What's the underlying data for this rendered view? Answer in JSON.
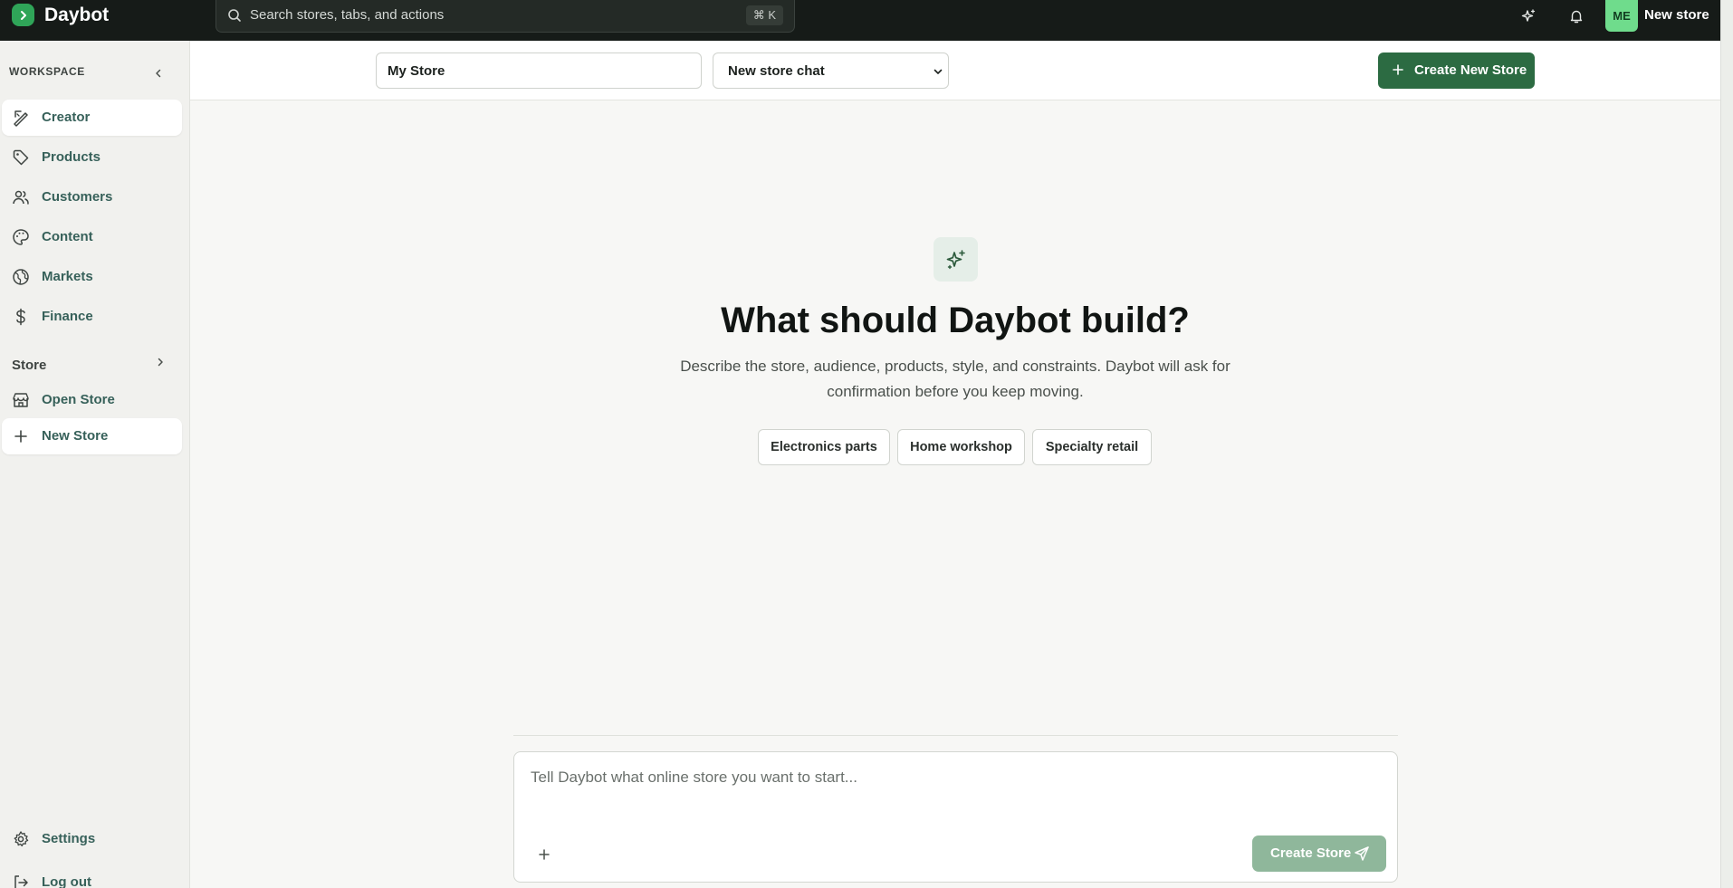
{
  "app": {
    "brand": "Daybot",
    "store_name": "New store",
    "avatar_initials": "ME"
  },
  "search": {
    "placeholder": "Search stores, tabs, and actions",
    "shortcut": "⌘ K"
  },
  "sidebar": {
    "section_label": "WORKSPACE",
    "items": [
      {
        "label": "Creator",
        "icon": "pen-ruler-icon",
        "active": true
      },
      {
        "label": "Products",
        "icon": "tag-icon"
      },
      {
        "label": "Customers",
        "icon": "users-icon"
      },
      {
        "label": "Content",
        "icon": "palette-icon"
      },
      {
        "label": "Markets",
        "icon": "globe-icon"
      },
      {
        "label": "Finance",
        "icon": "dollar-icon"
      }
    ],
    "store_section": "Store",
    "store_items": [
      {
        "label": "Open Store",
        "icon": "storefront-icon"
      },
      {
        "label": "New Store",
        "icon": "plus-icon",
        "active": true
      }
    ],
    "footer": [
      {
        "label": "Settings",
        "icon": "gear-icon"
      },
      {
        "label": "Log out",
        "icon": "logout-icon"
      }
    ]
  },
  "toolbar": {
    "store_input_value": "My Store",
    "chat_select_value": "New store chat",
    "create_button": "Create New Store"
  },
  "hero": {
    "title": "What should Daybot build?",
    "subtitle": "Describe the store, audience, products, style, and constraints. Daybot will ask for confirmation before you keep moving.",
    "chips": [
      "Electronics parts",
      "Home workshop",
      "Specialty retail"
    ]
  },
  "composer": {
    "placeholder": "Tell Daybot what online store you want to start...",
    "send_label": "Create Store"
  },
  "colors": {
    "topbar": "#161b18",
    "accent": "#2c6b42",
    "accent_disabled": "#8fb79b",
    "avatar": "#6fdc8c",
    "nav_text": "#37615a"
  }
}
